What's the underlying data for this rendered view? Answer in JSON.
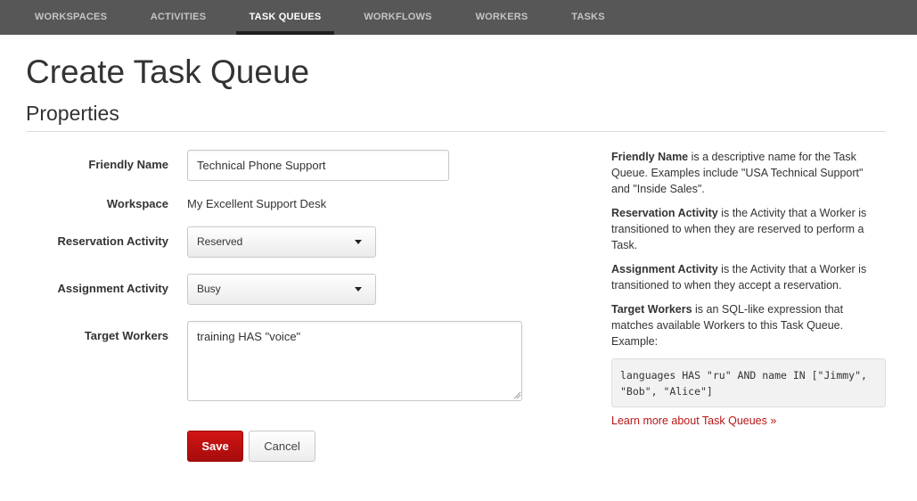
{
  "nav": {
    "tabs": [
      {
        "label": "WORKSPACES"
      },
      {
        "label": "ACTIVITIES"
      },
      {
        "label": "TASK QUEUES"
      },
      {
        "label": "WORKFLOWS"
      },
      {
        "label": "WORKERS"
      },
      {
        "label": "TASKS"
      }
    ],
    "active_tab": "TASK QUEUES"
  },
  "page": {
    "title": "Create Task Queue",
    "section_title": "Properties"
  },
  "form": {
    "friendly_name": {
      "label": "Friendly Name",
      "value": "Technical Phone Support"
    },
    "workspace": {
      "label": "Workspace",
      "value": "My Excellent Support Desk"
    },
    "reservation_activity": {
      "label": "Reservation Activity",
      "value": "Reserved"
    },
    "assignment_activity": {
      "label": "Assignment Activity",
      "value": "Busy"
    },
    "target_workers": {
      "label": "Target Workers",
      "value": "training HAS \"voice\""
    },
    "save_label": "Save",
    "cancel_label": "Cancel"
  },
  "help": {
    "friendly_name": {
      "term": "Friendly Name",
      "text": " is a descriptive name for the Task Queue. Examples include \"USA Technical Support\" and \"Inside Sales\"."
    },
    "reservation_activity": {
      "term": "Reservation Activity",
      "text": " is the Activity that a Worker is transitioned to when they are reserved to perform a Task."
    },
    "assignment_activity": {
      "term": "Assignment Activity",
      "text": " is the Activity that a Worker is transitioned to when they accept a reservation."
    },
    "target_workers": {
      "term": "Target Workers",
      "text": " is an SQL-like expression that matches available Workers to this Task Queue. Example:"
    },
    "example_line1": "languages HAS \"ru\" AND name IN [\"Jimmy\",",
    "example_line2": "\"Bob\", \"Alice\"]",
    "learn_more": "Learn more about Task Queues »"
  },
  "colors": {
    "nav_background": "#575757",
    "save_button": "#c41010",
    "link": "#b71616"
  }
}
